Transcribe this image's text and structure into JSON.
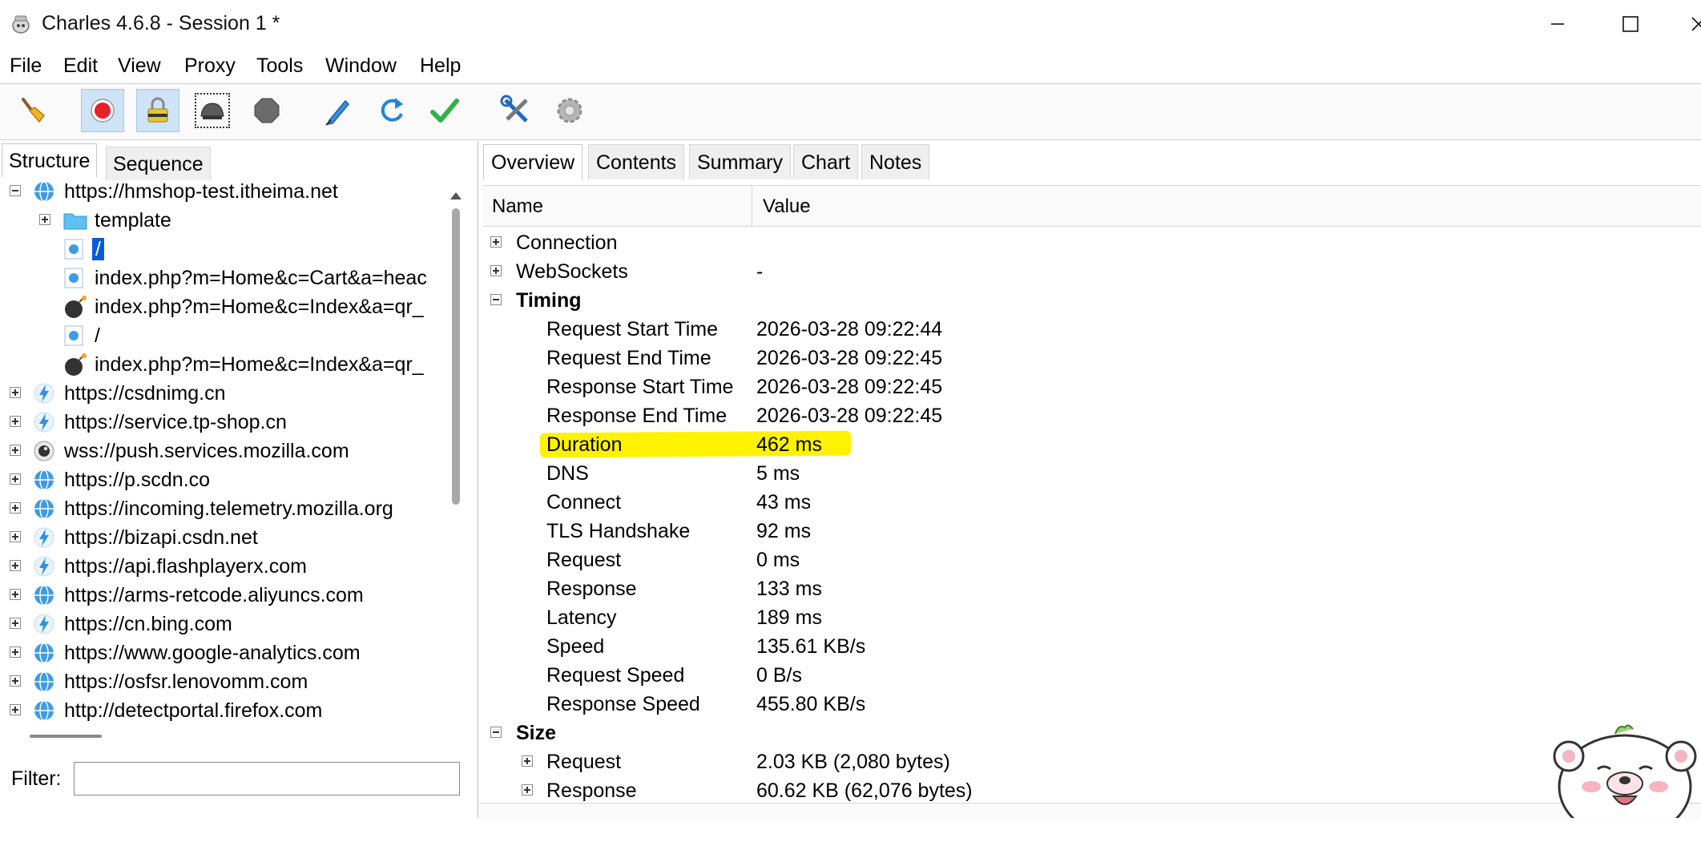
{
  "window": {
    "title": "Charles 4.6.8 - Session 1 *",
    "icon": "charles-pot-icon",
    "controls": [
      "minimize-icon",
      "maximize-icon",
      "close-icon"
    ]
  },
  "menu": {
    "file": "File",
    "edit": "Edit",
    "view": "View",
    "proxy": "Proxy",
    "tools": "Tools",
    "window": "Window",
    "help": "Help"
  },
  "toolbar": {
    "buttons": [
      {
        "name": "broom-icon",
        "state": "normal"
      },
      {
        "name": "record-icon",
        "state": "active"
      },
      {
        "name": "ssl-proxying-icon",
        "state": "active"
      },
      {
        "name": "throttle-icon",
        "state": "focused"
      },
      {
        "name": "breakpoint-icon",
        "state": "normal"
      },
      {
        "name": "compose-icon",
        "state": "normal"
      },
      {
        "name": "repeat-icon",
        "state": "normal"
      },
      {
        "name": "validate-icon",
        "state": "normal"
      },
      {
        "name": "tools-icon",
        "state": "normal"
      },
      {
        "name": "settings-icon",
        "state": "disabled"
      }
    ]
  },
  "left": {
    "tabs": {
      "structure": "Structure",
      "sequence": "Sequence"
    },
    "tree": {
      "root": "https://hmshop-test.itheima.net",
      "children": [
        {
          "label": "template",
          "icon": "folder-icon"
        },
        {
          "label": "/",
          "icon": "page-icon",
          "selected": true
        },
        {
          "label": "index.php?m=Home&c=Cart&a=heac",
          "icon": "page-icon"
        },
        {
          "label": "index.php?m=Home&c=Index&a=qr_",
          "icon": "bomb-icon"
        },
        {
          "label": "/",
          "icon": "page-icon"
        },
        {
          "label": "index.php?m=Home&c=Index&a=qr_",
          "icon": "bomb-icon"
        }
      ],
      "hosts": [
        {
          "label": "https://csdnimg.cn",
          "icon": "lightning-icon"
        },
        {
          "label": "https://service.tp-shop.cn",
          "icon": "lightning-icon"
        },
        {
          "label": "wss://push.services.mozilla.com",
          "icon": "websocket-icon"
        },
        {
          "label": "https://p.scdn.co",
          "icon": "globe-icon"
        },
        {
          "label": "https://incoming.telemetry.mozilla.org",
          "icon": "globe-icon"
        },
        {
          "label": "https://bizapi.csdn.net",
          "icon": "lightning-icon"
        },
        {
          "label": "https://api.flashplayerx.com",
          "icon": "lightning-icon"
        },
        {
          "label": "https://arms-retcode.aliyuncs.com",
          "icon": "globe-icon"
        },
        {
          "label": "https://cn.bing.com",
          "icon": "lightning-icon"
        },
        {
          "label": "https://www.google-analytics.com",
          "icon": "globe-icon"
        },
        {
          "label": "https://osfsr.lenovomm.com",
          "icon": "globe-icon"
        },
        {
          "label": "http://detectportal.firefox.com",
          "icon": "globe-icon"
        }
      ]
    },
    "filter": {
      "label": "Filter:",
      "value": ""
    }
  },
  "right": {
    "tabs": {
      "overview": "Overview",
      "contents": "Contents",
      "summary": "Summary",
      "chart": "Chart",
      "notes": "Notes"
    },
    "columns": {
      "name": "Name",
      "value": "Value"
    },
    "rows": {
      "connection": {
        "name": "Connection",
        "value": ""
      },
      "websockets": {
        "name": "WebSockets",
        "value": "-"
      },
      "timing": {
        "name": "Timing"
      },
      "request_start": {
        "name": "Request Start Time",
        "value": "2026-03-28 09:22:44"
      },
      "request_end": {
        "name": "Request End Time",
        "value": "2026-03-28 09:22:45"
      },
      "response_start": {
        "name": "Response Start Time",
        "value": "2026-03-28 09:22:45"
      },
      "response_end": {
        "name": "Response End Time",
        "value": "2026-03-28 09:22:45"
      },
      "duration": {
        "name": "Duration",
        "value": "462 ms"
      },
      "dns": {
        "name": "DNS",
        "value": "5 ms"
      },
      "connect": {
        "name": "Connect",
        "value": "43 ms"
      },
      "tls": {
        "name": "TLS Handshake",
        "value": "92 ms"
      },
      "request": {
        "name": "Request",
        "value": "0 ms"
      },
      "response": {
        "name": "Response",
        "value": "133 ms"
      },
      "latency": {
        "name": "Latency",
        "value": "189 ms"
      },
      "speed": {
        "name": "Speed",
        "value": "135.61 KB/s"
      },
      "request_speed": {
        "name": "Request Speed",
        "value": "0 B/s"
      },
      "response_speed": {
        "name": "Response Speed",
        "value": "455.80 KB/s"
      },
      "size": {
        "name": "Size"
      },
      "size_request": {
        "name": "Request",
        "value": "2.03 KB (2,080 bytes)"
      },
      "size_response": {
        "name": "Response",
        "value": "60.62 KB (62,076 bytes)"
      }
    },
    "highlight_color": "#fff200"
  }
}
